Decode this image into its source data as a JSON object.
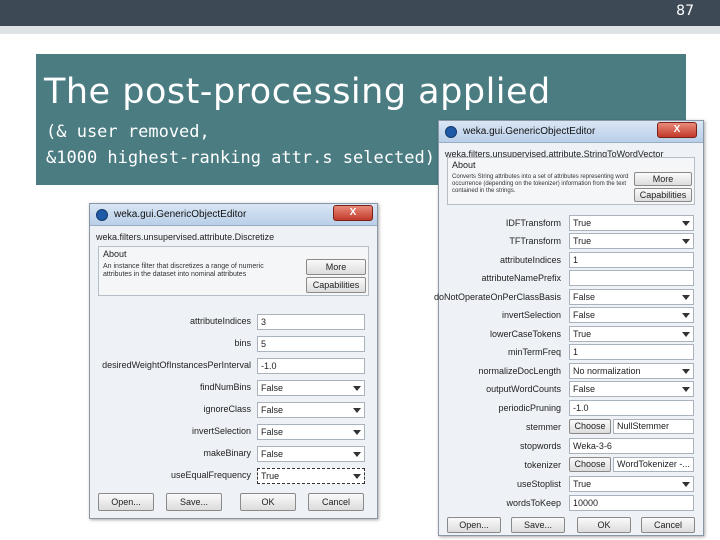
{
  "slide": {
    "page_number": "87",
    "title": "The post-processing applied",
    "subtitle_line1": "(& user removed,",
    "subtitle_line2": "&1000 highest-ranking attr.s selected)"
  },
  "editor_left": {
    "window_title": "weka.gui.GenericObjectEditor",
    "close_label": "X",
    "class_name": "weka.filters.unsupervised.attribute.Discretize",
    "about_header": "About",
    "about_text": "An instance filter that discretizes a range of numeric attributes in the dataset into nominal attributes",
    "more_label": "More",
    "capabilities_label": "Capabilities",
    "params": [
      {
        "label": "attributeIndices",
        "value": "3"
      },
      {
        "label": "bins",
        "value": "5"
      },
      {
        "label": "desiredWeightOfInstancesPerInterval",
        "value": "-1.0"
      },
      {
        "label": "findNumBins",
        "value": "False"
      },
      {
        "label": "ignoreClass",
        "value": "False"
      },
      {
        "label": "invertSelection",
        "value": "False"
      },
      {
        "label": "makeBinary",
        "value": "False"
      },
      {
        "label": "useEqualFrequency",
        "value": "True"
      }
    ],
    "buttons": {
      "open": "Open...",
      "save": "Save...",
      "ok": "OK",
      "cancel": "Cancel"
    }
  },
  "editor_right": {
    "window_title": "weka.gui.GenericObjectEditor",
    "close_label": "X",
    "class_name": "weka.filters.unsupervised.attribute.StringToWordVector",
    "about_header": "About",
    "about_text": "Converts String attributes into a set of attributes representing word occurrence (depending on the tokenizer) information from the text contained in the strings.",
    "more_label": "More",
    "capabilities_label": "Capabilities",
    "params": [
      {
        "label": "IDFTransform",
        "value": "True"
      },
      {
        "label": "TFTransform",
        "value": "True"
      },
      {
        "label": "attributeIndices",
        "value": "1"
      },
      {
        "label": "attributeNamePrefix",
        "value": ""
      },
      {
        "label": "doNotOperateOnPerClassBasis",
        "value": "False"
      },
      {
        "label": "invertSelection",
        "value": "False"
      },
      {
        "label": "lowerCaseTokens",
        "value": "True"
      },
      {
        "label": "minTermFreq",
        "value": "1"
      },
      {
        "label": "normalizeDocLength",
        "value": "No normalization"
      },
      {
        "label": "outputWordCounts",
        "value": "False"
      },
      {
        "label": "periodicPruning",
        "value": "-1.0"
      },
      {
        "label": "stemmer",
        "choose": "Choose",
        "value": "NullStemmer"
      },
      {
        "label": "stopwords",
        "value": "Weka-3-6"
      },
      {
        "label": "tokenizer",
        "choose": "Choose",
        "value": "WordTokenizer -..."
      },
      {
        "label": "useStoplist",
        "value": "True"
      },
      {
        "label": "wordsToKeep",
        "value": "10000"
      }
    ],
    "buttons": {
      "open": "Open...",
      "save": "Save...",
      "ok": "OK",
      "cancel": "Cancel"
    }
  }
}
